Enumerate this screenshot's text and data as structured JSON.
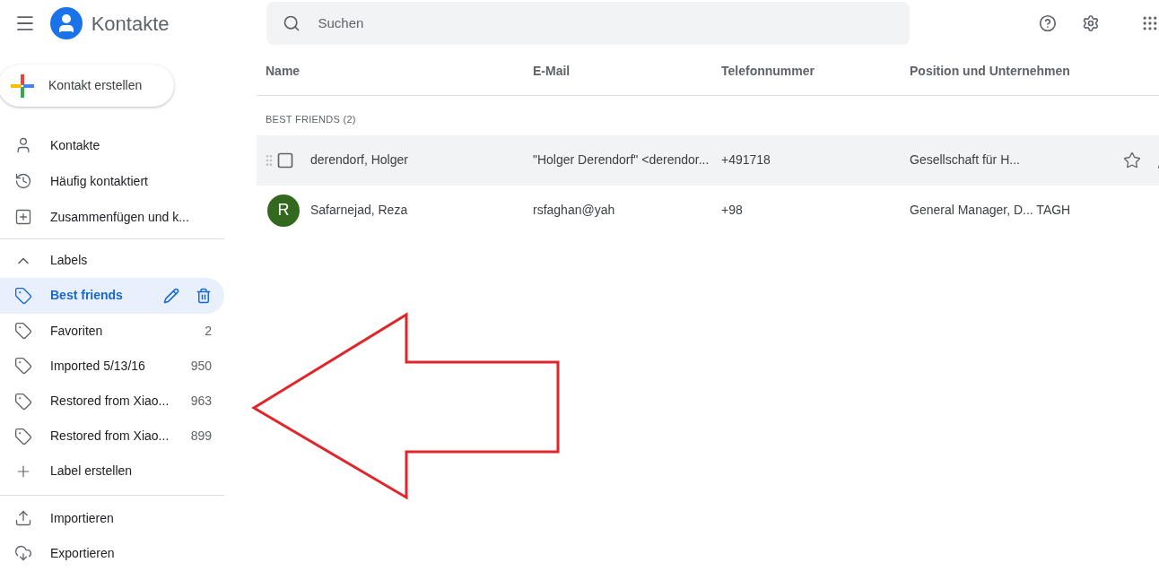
{
  "app": {
    "title": "Kontakte"
  },
  "create_button": {
    "label": "Kontakt erstellen"
  },
  "search": {
    "placeholder": "Suchen"
  },
  "nav": [
    {
      "kind": "contacts",
      "label": "Kontakte"
    },
    {
      "kind": "history",
      "label": "Häufig kontaktiert"
    },
    {
      "kind": "merge",
      "label": "Zusammenfügen und k..."
    }
  ],
  "labels_section": {
    "label": "Labels",
    "expanded": true,
    "items": [
      {
        "label": "Best friends",
        "selected": true
      },
      {
        "label": "Favoriten",
        "count": "2",
        "selected": false
      },
      {
        "label": "Imported 5/13/16",
        "count": "950",
        "selected": false
      },
      {
        "label": "Restored from Xiao...",
        "count": "963",
        "selected": false
      },
      {
        "label": "Restored from Xiao...",
        "count": "899",
        "selected": false
      }
    ],
    "create_label": "Label erstellen"
  },
  "bottom_nav": [
    {
      "kind": "upload",
      "label": "Importieren"
    },
    {
      "kind": "cloud",
      "label": "Exportieren"
    }
  ],
  "table": {
    "columns": [
      "Name",
      "E-Mail",
      "Telefonnummer",
      "Position und Unternehmen"
    ],
    "group_heading": "BEST FRIENDS (2)",
    "rows": [
      {
        "hovered": true,
        "name": "derendorf, Holger",
        "email": "\"Holger Derendorf\" <derendor...",
        "phone": "+491718",
        "position": "Gesellschaft für H..."
      },
      {
        "avatar": "R",
        "hovered": false,
        "name": "Safarnejad, Reza",
        "email": "rsfaghan@yah",
        "phone": "+98",
        "position": "General Manager, D... TAGH"
      }
    ]
  }
}
